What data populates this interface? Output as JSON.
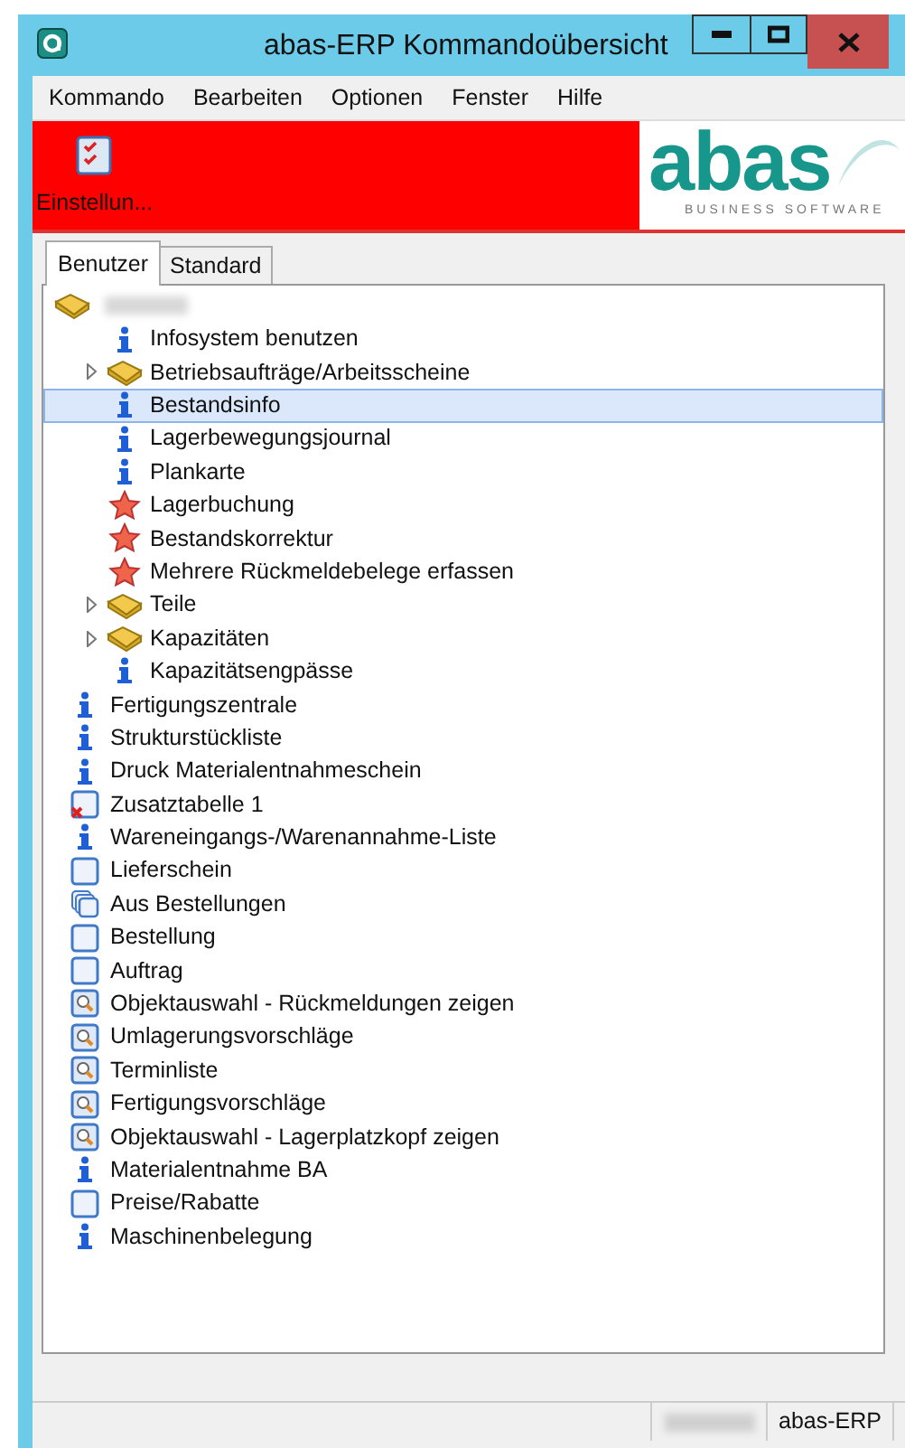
{
  "window": {
    "title": "abas-ERP Kommandoübersicht"
  },
  "menu": [
    "Kommando",
    "Bearbeiten",
    "Optionen",
    "Fenster",
    "Hilfe"
  ],
  "toolbar": {
    "buttons": [
      {
        "label": "Einstellun..."
      }
    ],
    "logo": {
      "wordmark": "abas",
      "tagline": "BUSINESS SOFTWARE"
    }
  },
  "tabs": [
    {
      "label": "Benutzer",
      "selected": true
    },
    {
      "label": "Standard",
      "selected": false
    }
  ],
  "tree": [
    {
      "kind": "book",
      "redacted": true,
      "expanded": true,
      "selected": false,
      "children": [
        {
          "kind": "info",
          "label": "Infosystem benutzen",
          "selected": false
        },
        {
          "kind": "book",
          "label": "Betriebsaufträge/Arbeitsscheine",
          "expanded": false,
          "selected": false
        },
        {
          "kind": "info",
          "label": "Bestandsinfo",
          "selected": true
        },
        {
          "kind": "info",
          "label": "Lagerbewegungsjournal",
          "selected": false
        },
        {
          "kind": "info",
          "label": "Plankarte",
          "selected": false
        },
        {
          "kind": "star",
          "label": "Lagerbuchung",
          "selected": false
        },
        {
          "kind": "star",
          "label": "Bestandskorrektur",
          "selected": false
        },
        {
          "kind": "star",
          "label": "Mehrere Rückmeldebelege erfassen",
          "selected": false
        },
        {
          "kind": "book",
          "label": "Teile",
          "expanded": false,
          "selected": false
        },
        {
          "kind": "book",
          "label": "Kapazitäten",
          "expanded": false,
          "selected": false
        },
        {
          "kind": "info",
          "label": "Kapazitätsengpässe",
          "selected": false
        }
      ]
    },
    {
      "kind": "info",
      "label": "Fertigungszentrale",
      "selected": false
    },
    {
      "kind": "info",
      "label": "Strukturstückliste",
      "selected": false
    },
    {
      "kind": "info",
      "label": "Druck Materialentnahmeschein",
      "selected": false
    },
    {
      "kind": "form_error",
      "label": "Zusatztabelle 1",
      "selected": false
    },
    {
      "kind": "info",
      "label": "Wareneingangs-/Warenannahme-Liste",
      "selected": false
    },
    {
      "kind": "form",
      "label": "Lieferschein",
      "selected": false
    },
    {
      "kind": "forms",
      "label": "Aus Bestellungen",
      "selected": false
    },
    {
      "kind": "form",
      "label": "Bestellung",
      "selected": false
    },
    {
      "kind": "form",
      "label": "Auftrag",
      "selected": false
    },
    {
      "kind": "search",
      "label": "Objektauswahl - Rückmeldungen zeigen",
      "selected": false
    },
    {
      "kind": "search",
      "label": "Umlagerungsvorschläge",
      "selected": false
    },
    {
      "kind": "search",
      "label": "Terminliste",
      "selected": false
    },
    {
      "kind": "search",
      "label": "Fertigungsvorschläge",
      "selected": false
    },
    {
      "kind": "search",
      "label": "Objektauswahl - Lagerplatzkopf zeigen",
      "selected": false
    },
    {
      "kind": "info",
      "label": "Materialentnahme BA",
      "selected": false
    },
    {
      "kind": "form",
      "label": "Preise/Rabatte",
      "selected": false
    },
    {
      "kind": "info",
      "label": "Maschinenbelegung",
      "selected": false
    }
  ],
  "status_bar": [
    {
      "kind": "redacted"
    },
    {
      "kind": "text",
      "text": "abas-ERP"
    }
  ]
}
